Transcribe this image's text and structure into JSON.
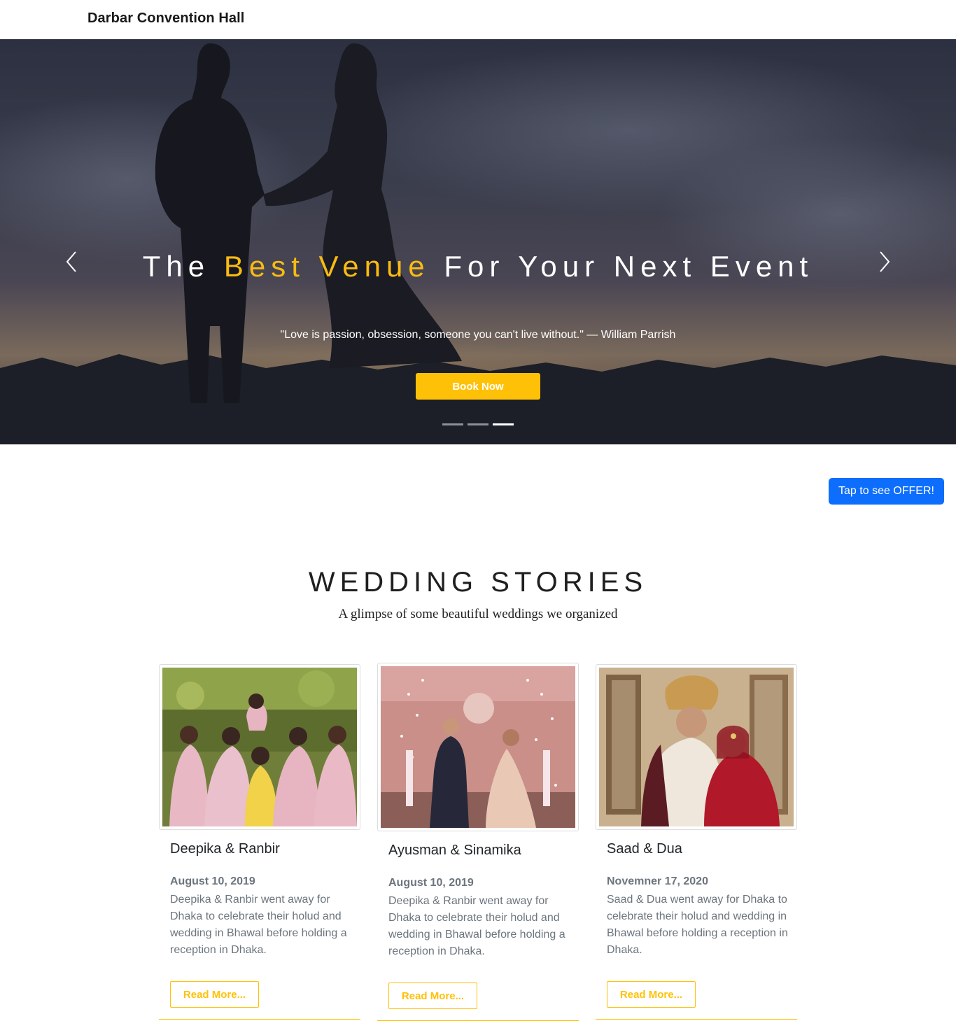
{
  "navbar": {
    "brand": "Darbar Convention Hall"
  },
  "hero": {
    "title_part1": "The ",
    "title_accent": "Best Venue",
    "title_part2": " For Your Next Event",
    "quote": "\"Love is passion, obsession, someone you can't live without.\" — William Parrish",
    "book_label": "Book Now",
    "prev_icon": "chevron-left-icon",
    "next_icon": "chevron-right-icon",
    "slide_count": 3,
    "active_slide": 3,
    "accent_color": "#f9bb12"
  },
  "offer": {
    "label": "Tap to see OFFER!",
    "color": "#0d6efd"
  },
  "stories": {
    "title": "WEDDING STORIES",
    "subtitle": "A glimpse of some beautiful weddings we organized",
    "cards": [
      {
        "name": "Deepika & Ranbir",
        "date": "August 10, 2019",
        "description": "Deepika & Ranbir went away for Dhaka to celebrate their holud and wedding in Bhawal before holding a reception in Dhaka.",
        "button": "Read More..."
      },
      {
        "name": "Ayusman & Sinamika",
        "date": "August 10, 2019",
        "description": "Deepika & Ranbir went away for Dhaka to celebrate their holud and wedding in Bhawal before holding a reception in Dhaka.",
        "button": "Read More..."
      },
      {
        "name": "Saad & Dua",
        "date": "Novemner 17, 2020",
        "description": "Saad & Dua went away for Dhaka to celebrate their holud and wedding in Bhawal before holding a reception in Dhaka.",
        "button": "Read More..."
      }
    ]
  }
}
